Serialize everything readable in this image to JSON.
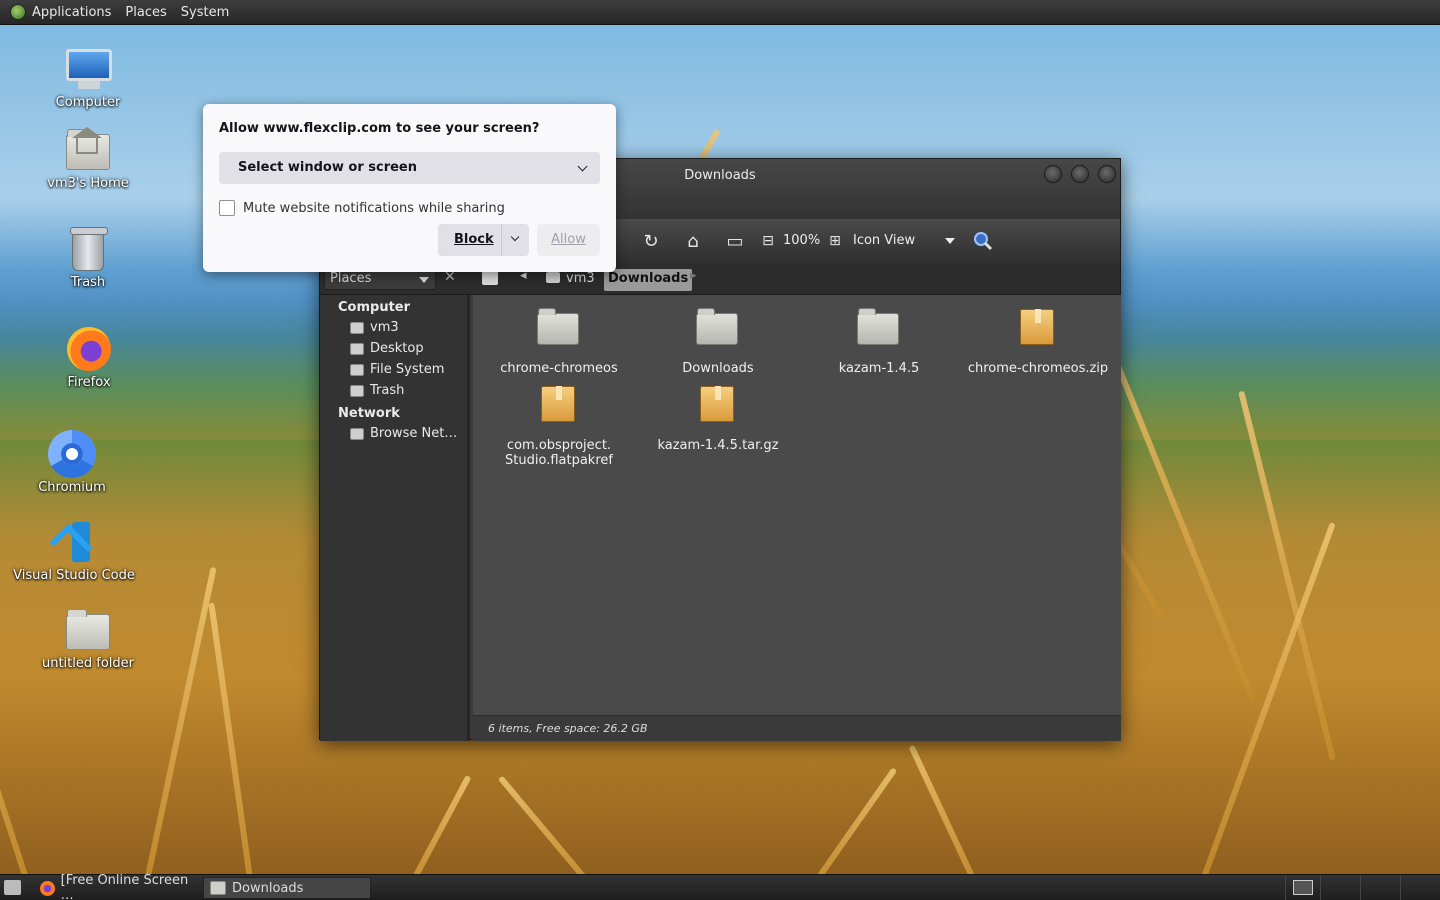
{
  "top_panel": {
    "menus": [
      "Applications",
      "Places",
      "System"
    ]
  },
  "desktop": {
    "icons": [
      {
        "label": "Computer",
        "icon": "computer-icon"
      },
      {
        "label": "vm3's Home",
        "icon": "home-folder-icon"
      },
      {
        "label": "Trash",
        "icon": "trash-icon"
      },
      {
        "label": "Firefox",
        "icon": "firefox-icon"
      },
      {
        "label": "Chromium",
        "icon": "chromium-icon"
      },
      {
        "label": "Visual Studio Code",
        "icon": "vscode-icon"
      },
      {
        "label": "untitled folder",
        "icon": "folder-icon"
      }
    ]
  },
  "dialog": {
    "title": "Allow www.flexclip.com to see your screen?",
    "select_label": "Select window or screen",
    "checkbox_label": "Mute website notifications while sharing",
    "checkbox_checked": false,
    "block_label": "Block",
    "allow_label": "Allow"
  },
  "file_manager": {
    "title": "Downloads",
    "toolbar": {
      "zoom": "100%",
      "view_mode": "Icon View"
    },
    "places_label": "Places",
    "breadcrumbs": [
      "vm3",
      "Downloads"
    ],
    "sidebar": {
      "sections": [
        {
          "heading": "Computer",
          "items": [
            "vm3",
            "Desktop",
            "File System",
            "Trash"
          ]
        },
        {
          "heading": "Network",
          "items": [
            "Browse Net…"
          ]
        }
      ]
    },
    "files": [
      {
        "name": "chrome-chromeos",
        "type": "folder"
      },
      {
        "name": "Downloads",
        "type": "folder"
      },
      {
        "name": "kazam-1.4.5",
        "type": "folder"
      },
      {
        "name": "chrome-chromeos.zip",
        "type": "package"
      },
      {
        "name_line1": "com.obsproject.",
        "name_line2": "Studio.flatpakref",
        "type": "package"
      },
      {
        "name": "kazam-1.4.5.tar.gz",
        "type": "package"
      }
    ],
    "status": "6 items, Free space: 26.2 GB"
  },
  "taskbar": {
    "tasks": [
      {
        "label": "[Free Online Screen …",
        "icon": "firefox-icon",
        "active": false
      },
      {
        "label": "Downloads",
        "icon": "folder-icon",
        "active": true
      }
    ]
  },
  "colors": {
    "panel_bg": "#262626",
    "dialog_bg": "#f9f9fb",
    "fm_content_bg": "#4a4a4a",
    "breadcrumb_active": "#9a9a9a"
  }
}
